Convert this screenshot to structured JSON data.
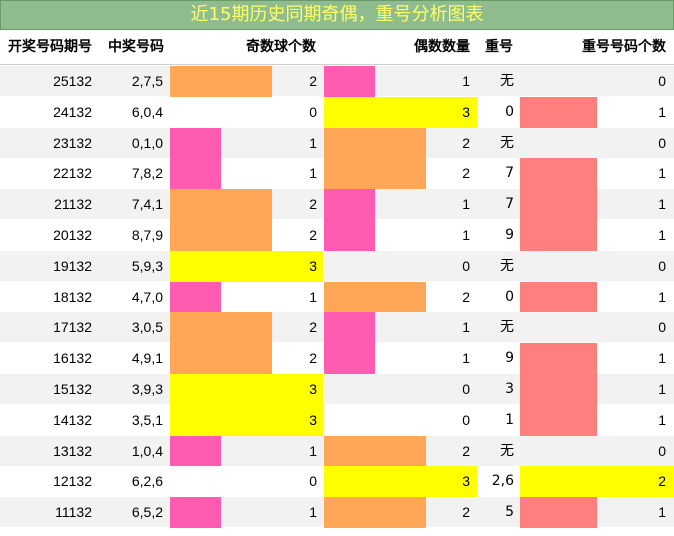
{
  "title": "近15期历史同期奇偶，重号分析图表",
  "headers": {
    "period": "开奖号码期号",
    "numbers": "中奖号码",
    "odd": "奇数球个数",
    "even": "偶数数量",
    "repeat": "重号",
    "repeat_count": "重号号码个数"
  },
  "colors": {
    "level1": "#ff5bb0",
    "level2": "#ffa657",
    "level3": "#ffff00",
    "repeat_bar": "#ff7f7f",
    "repeat_bar_max": "#ffff00",
    "title_bg": "#8fbc8f",
    "title_text": "#ffff66"
  },
  "chart_data": {
    "type": "table",
    "columns": [
      "开奖号码期号",
      "中奖号码",
      "奇数球个数",
      "偶数数量",
      "重号",
      "重号号码个数"
    ],
    "rows": [
      {
        "period": "25132",
        "numbers": "2,7,5",
        "odd": 2,
        "even": 1,
        "repeat": "无",
        "repeat_count": 0
      },
      {
        "period": "24132",
        "numbers": "6,0,4",
        "odd": 0,
        "even": 3,
        "repeat": "0",
        "repeat_count": 1
      },
      {
        "period": "23132",
        "numbers": "0,1,0",
        "odd": 1,
        "even": 2,
        "repeat": "无",
        "repeat_count": 0
      },
      {
        "period": "22132",
        "numbers": "7,8,2",
        "odd": 1,
        "even": 2,
        "repeat": "7",
        "repeat_count": 1
      },
      {
        "period": "21132",
        "numbers": "7,4,1",
        "odd": 2,
        "even": 1,
        "repeat": "7",
        "repeat_count": 1
      },
      {
        "period": "20132",
        "numbers": "8,7,9",
        "odd": 2,
        "even": 1,
        "repeat": "9",
        "repeat_count": 1
      },
      {
        "period": "19132",
        "numbers": "5,9,3",
        "odd": 3,
        "even": 0,
        "repeat": "无",
        "repeat_count": 0
      },
      {
        "period": "18132",
        "numbers": "4,7,0",
        "odd": 1,
        "even": 2,
        "repeat": "0",
        "repeat_count": 1
      },
      {
        "period": "17132",
        "numbers": "3,0,5",
        "odd": 2,
        "even": 1,
        "repeat": "无",
        "repeat_count": 0
      },
      {
        "period": "16132",
        "numbers": "4,9,1",
        "odd": 2,
        "even": 1,
        "repeat": "9",
        "repeat_count": 1
      },
      {
        "period": "15132",
        "numbers": "3,9,3",
        "odd": 3,
        "even": 0,
        "repeat": "3",
        "repeat_count": 1
      },
      {
        "period": "14132",
        "numbers": "3,5,1",
        "odd": 3,
        "even": 0,
        "repeat": "1",
        "repeat_count": 1
      },
      {
        "period": "13132",
        "numbers": "1,0,4",
        "odd": 1,
        "even": 2,
        "repeat": "无",
        "repeat_count": 0
      },
      {
        "period": "12132",
        "numbers": "6,2,6",
        "odd": 0,
        "even": 3,
        "repeat": "2,6",
        "repeat_count": 2
      },
      {
        "period": "11132",
        "numbers": "6,5,2",
        "odd": 1,
        "even": 2,
        "repeat": "5",
        "repeat_count": 1
      }
    ],
    "odd_even_max": 3,
    "repeat_count_max": 2
  }
}
